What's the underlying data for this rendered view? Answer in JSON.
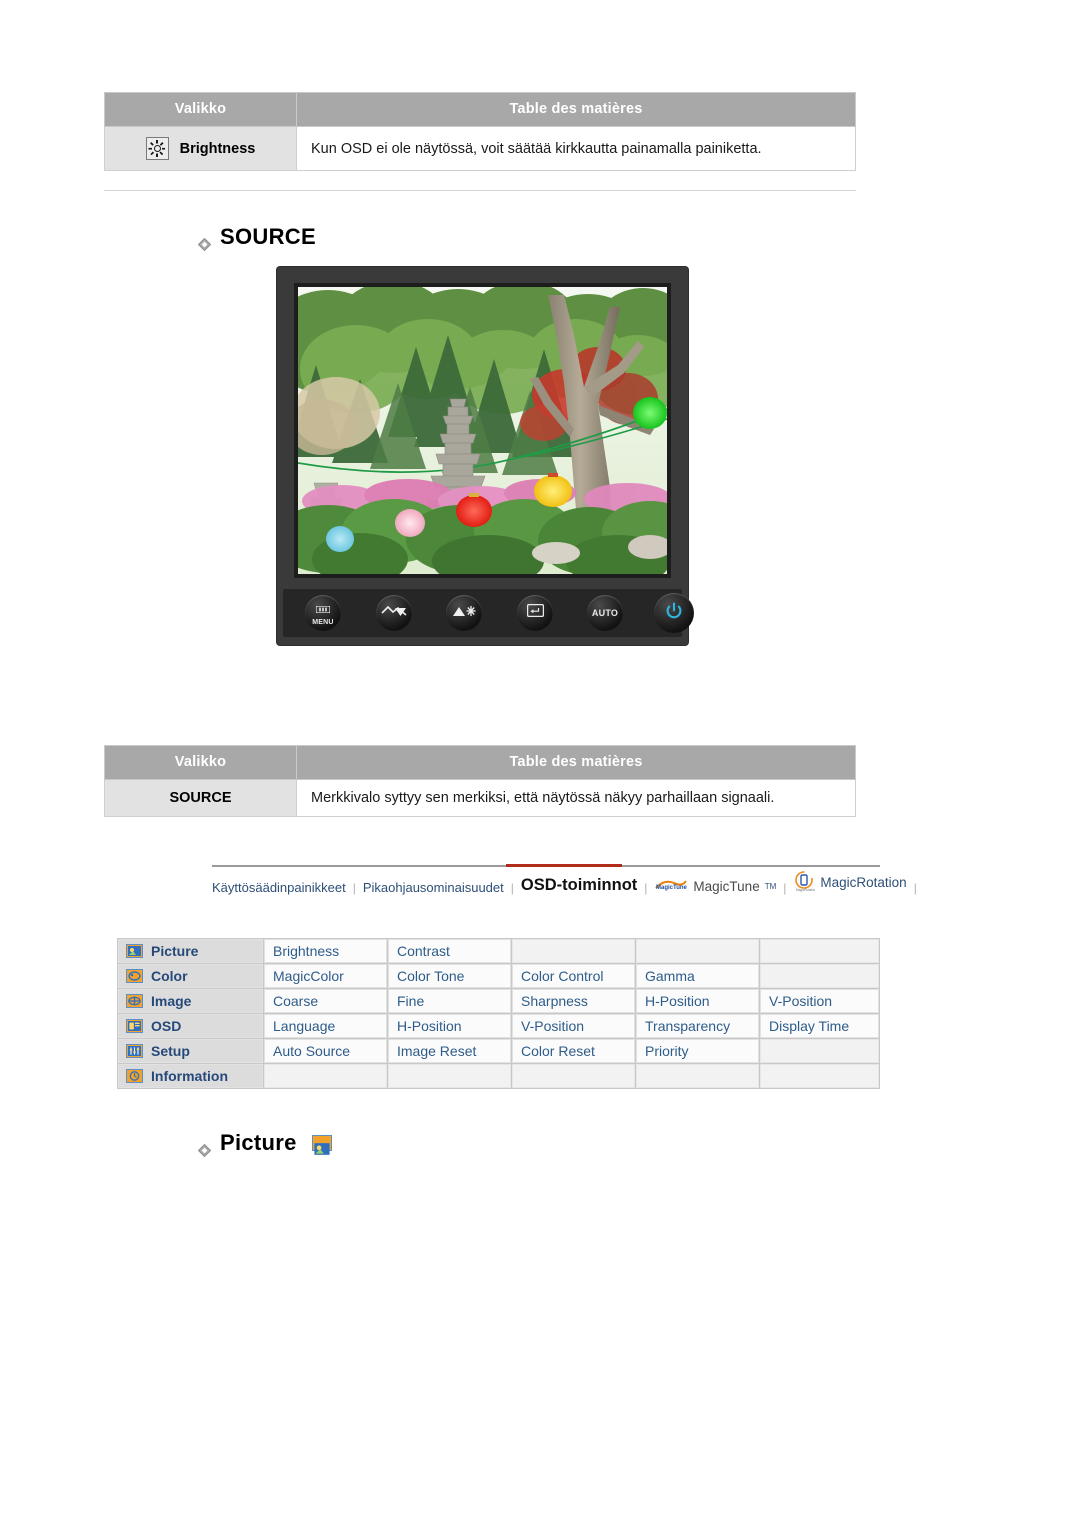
{
  "tables": {
    "brightness": {
      "header_menu": "Valikko",
      "header_toc": "Table des matières",
      "row_label": "Brightness",
      "row_desc": "Kun OSD ei ole näytössä, voit säätää kirkkautta painamalla painiketta.",
      "icon": "sun-icon"
    },
    "source": {
      "header_menu": "Valikko",
      "header_toc": "Table des matières",
      "row_label": "SOURCE",
      "row_desc": "Merkkivalo syttyy sen merkiksi, että näytössä näkyy parhaillaan signaali."
    }
  },
  "headings": {
    "source": "SOURCE",
    "picture": "Picture"
  },
  "monitor": {
    "buttons": [
      {
        "name": "menu-button",
        "label": "MENU",
        "icon": "menu-icon"
      },
      {
        "name": "down-button",
        "label": "",
        "icon": "down-arrow-icon"
      },
      {
        "name": "up-brightness-button",
        "label": "",
        "icon": "up-brightness-icon"
      },
      {
        "name": "enter-source-button",
        "label": "",
        "icon": "enter-icon"
      },
      {
        "name": "auto-button",
        "label": "AUTO",
        "icon": "auto-icon"
      },
      {
        "name": "power-button",
        "label": "",
        "icon": "power-icon"
      }
    ],
    "power_color": "#2ab6e0",
    "bezel_color": "#3a3a3a",
    "screen_caption": "Korean garden with stone pagoda and paper lanterns"
  },
  "navbar": {
    "items": [
      {
        "label": "Käyttösäädinpainikkeet",
        "active": false,
        "icon": ""
      },
      {
        "label": "Pikaohjausominaisuudet",
        "active": false,
        "icon": ""
      },
      {
        "label": "OSD-toiminnot",
        "active": true,
        "icon": ""
      },
      {
        "label": "MagicTune",
        "active": false,
        "icon": "magictune-logo-icon",
        "tm": "TM"
      },
      {
        "label": "MagicRotation",
        "active": false,
        "icon": "magicrotation-logo-icon"
      }
    ],
    "separator": "|",
    "active_underline_color": "#b02b19"
  },
  "osd_grid": {
    "rows": [
      {
        "icon": "picture-icon",
        "name": "Picture",
        "items": [
          "Brightness",
          "Contrast",
          "",
          "",
          ""
        ]
      },
      {
        "icon": "color-icon",
        "name": "Color",
        "items": [
          "MagicColor",
          "Color Tone",
          "Color Control",
          "Gamma",
          ""
        ]
      },
      {
        "icon": "image-icon",
        "name": "Image",
        "items": [
          "Coarse",
          "Fine",
          "Sharpness",
          "H-Position",
          "V-Position"
        ]
      },
      {
        "icon": "osd-icon",
        "name": "OSD",
        "items": [
          "Language",
          "H-Position",
          "V-Position",
          "Transparency",
          "Display Time"
        ]
      },
      {
        "icon": "setup-icon",
        "name": "Setup",
        "items": [
          "Auto Source",
          "Image Reset",
          "Color Reset",
          "Priority",
          ""
        ]
      },
      {
        "icon": "information-icon",
        "name": "Information",
        "items": [
          "",
          "",
          "",
          "",
          ""
        ]
      }
    ]
  },
  "colors": {
    "table_header_bg": "#a8a8a8",
    "menu_cell_bg": "#e2e2e2",
    "grid_link": "#2e5c8a",
    "icon_orange": "#f3a22b",
    "icon_border_blue": "#5b8fc9",
    "accent_red": "#b02b19"
  }
}
